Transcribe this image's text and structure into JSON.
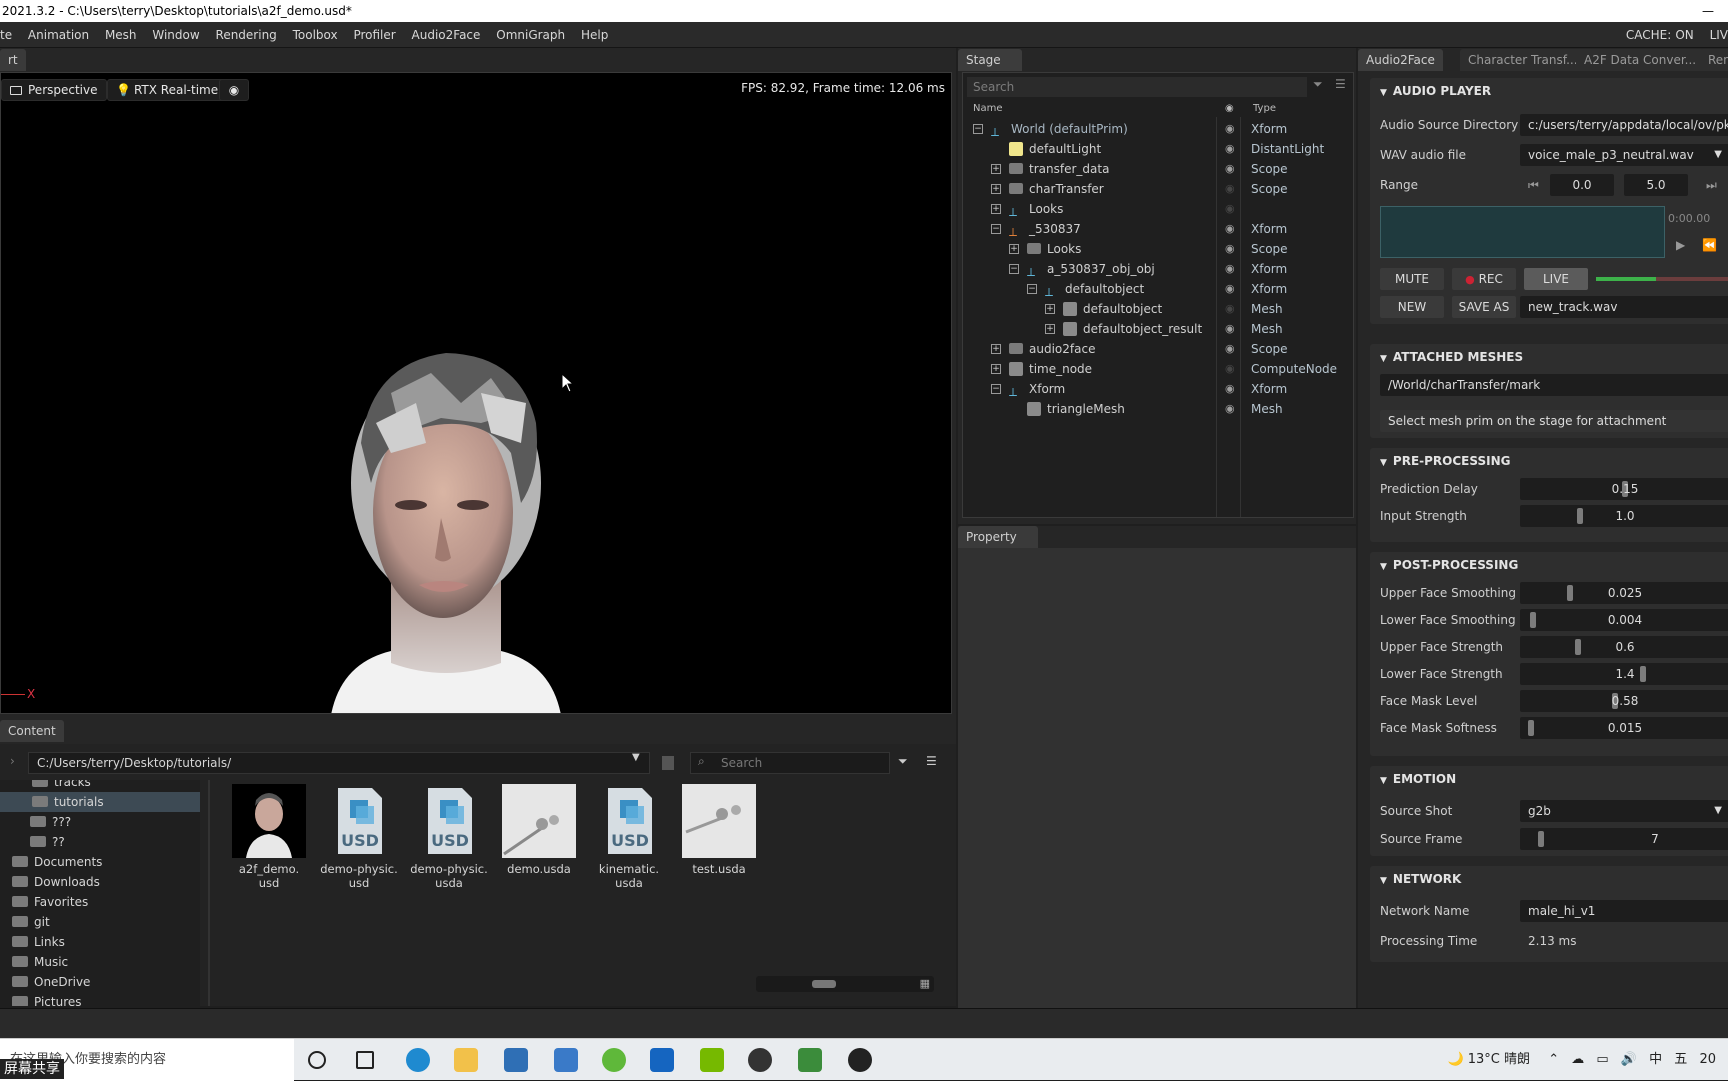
{
  "window": {
    "title": "2021.3.2 - C:\\Users\\terry\\Desktop\\tutorials\\a2f_demo.usd*",
    "minimize": "—"
  },
  "menu": {
    "items": [
      "te",
      "Animation",
      "Mesh",
      "Window",
      "Rendering",
      "Toolbox",
      "Profiler",
      "Audio2Face",
      "OmniGraph",
      "Help"
    ],
    "cache_label": "CACHE:",
    "cache_value": "ON",
    "live": "LIV"
  },
  "viewport": {
    "tab": "rt",
    "camera": "Perspective",
    "renderer": "RTX Real-time",
    "fps": "FPS: 82.92, Frame time: 12.06 ms",
    "axis_x": "X"
  },
  "content": {
    "tab": "Content",
    "path": "C:/Users/terry/Desktop/tutorials/",
    "search_placeholder": "Search",
    "tree": [
      "tracks",
      "tutorials",
      "???",
      "??",
      "Documents",
      "Downloads",
      "Favorites",
      "git",
      "Links",
      "Music",
      "OneDrive",
      "Pictures"
    ],
    "files": [
      {
        "name": "a2f_demo.\nusd",
        "kind": "head"
      },
      {
        "name": "demo-physic.\nusd",
        "kind": "usd"
      },
      {
        "name": "demo-physic.\nusda",
        "kind": "usd"
      },
      {
        "name": "demo.usda",
        "kind": "preview"
      },
      {
        "name": "kinematic.\nusda",
        "kind": "usd"
      },
      {
        "name": "test.usda",
        "kind": "preview"
      }
    ]
  },
  "stage": {
    "tab": "Stage",
    "search_placeholder": "Search",
    "col_name": "Name",
    "col_type": "Type",
    "rows": [
      {
        "name": "World (defaultPrim)",
        "type": "Xform",
        "depth": 0,
        "exp": "−",
        "icon": "xform",
        "eye": true
      },
      {
        "name": "defaultLight",
        "type": "DistantLight",
        "depth": 1,
        "exp": "",
        "icon": "light",
        "eye": true
      },
      {
        "name": "transfer_data",
        "type": "Scope",
        "depth": 1,
        "exp": "+",
        "icon": "folder",
        "eye": true
      },
      {
        "name": "charTransfer",
        "type": "Scope",
        "depth": 1,
        "exp": "+",
        "icon": "folder",
        "eye": false
      },
      {
        "name": "Looks",
        "type": "",
        "depth": 1,
        "exp": "+",
        "icon": "xform",
        "eye": false
      },
      {
        "name": "_530837",
        "type": "Xform",
        "depth": 1,
        "exp": "−",
        "icon": "xform-orange",
        "eye": true
      },
      {
        "name": "Looks",
        "type": "Scope",
        "depth": 2,
        "exp": "+",
        "icon": "folder",
        "eye": true
      },
      {
        "name": "a_530837_obj_obj",
        "type": "Xform",
        "depth": 2,
        "exp": "−",
        "icon": "xform",
        "eye": true
      },
      {
        "name": "defaultobject",
        "type": "Xform",
        "depth": 3,
        "exp": "−",
        "icon": "xform",
        "eye": true
      },
      {
        "name": "defaultobject",
        "type": "Mesh",
        "depth": 4,
        "exp": "+",
        "icon": "mesh",
        "eye": false
      },
      {
        "name": "defaultobject_result",
        "type": "Mesh",
        "depth": 4,
        "exp": "+",
        "icon": "mesh",
        "eye": true
      },
      {
        "name": "audio2face",
        "type": "Scope",
        "depth": 1,
        "exp": "+",
        "icon": "folder",
        "eye": true
      },
      {
        "name": "time_node",
        "type": "ComputeNode",
        "depth": 1,
        "exp": "+",
        "icon": "mesh",
        "eye": false
      },
      {
        "name": "Xform",
        "type": "Xform",
        "depth": 1,
        "exp": "−",
        "icon": "xform",
        "eye": true
      },
      {
        "name": "triangleMesh",
        "type": "Mesh",
        "depth": 2,
        "exp": "",
        "icon": "mesh",
        "eye": true
      }
    ]
  },
  "property": {
    "tab": "Property"
  },
  "a2f": {
    "tabs": [
      "Audio2Face",
      "Character Transf...",
      "A2F Data Conver...",
      "Ren"
    ],
    "audio_player": {
      "title": "AUDIO PLAYER",
      "source_dir_label": "Audio Source Directory",
      "source_dir_value": "c:/users/terry/appdata/local/ov/pk",
      "wav_label": "WAV audio file",
      "wav_value": "voice_male_p3_neutral.wav",
      "range_label": "Range",
      "range_start": "0.0",
      "range_end": "5.0",
      "time": "0:00.00",
      "mute": "MUTE",
      "rec": "REC",
      "live": "LIVE",
      "new": "NEW",
      "save_as": "SAVE AS",
      "track": "new_track.wav"
    },
    "attached": {
      "title": "ATTACHED MESHES",
      "mesh": "/World/charTransfer/mark",
      "hint": "Select mesh prim on the stage for attachment"
    },
    "pre": {
      "title": "PRE-PROCESSING",
      "rows": [
        {
          "label": "Prediction Delay",
          "value": "0.15",
          "level": 0.5
        },
        {
          "label": "Input Strength",
          "value": "1.0",
          "level": 0.28
        }
      ]
    },
    "post": {
      "title": "POST-PROCESSING",
      "rows": [
        {
          "label": "Upper Face Smoothing",
          "value": "0.025",
          "level": 0.23
        },
        {
          "label": "Lower Face Smoothing",
          "value": "0.004",
          "level": 0.05
        },
        {
          "label": "Upper Face Strength",
          "value": "0.6",
          "level": 0.27
        },
        {
          "label": "Lower Face Strength",
          "value": "1.4",
          "level": 0.59
        },
        {
          "label": "Face Mask Level",
          "value": "0.58",
          "level": 0.45
        },
        {
          "label": "Face Mask Softness",
          "value": "0.015",
          "level": 0.04
        }
      ]
    },
    "emotion": {
      "title": "EMOTION",
      "shot_label": "Source Shot",
      "shot_value": "g2b",
      "frame_label": "Source Frame",
      "frame_value": "7"
    },
    "network": {
      "title": "NETWORK",
      "name_label": "Network Name",
      "name_value": "male_hi_v1",
      "time_label": "Processing Time",
      "time_value": "2.13 ms"
    }
  },
  "taskbar": {
    "search_text": "在这里输入你要搜索的内容",
    "share": "屏幕共享",
    "weather": "13°C",
    "weather_desc": "晴朗",
    "ime": "中",
    "ime2": "五",
    "clock": "20"
  }
}
